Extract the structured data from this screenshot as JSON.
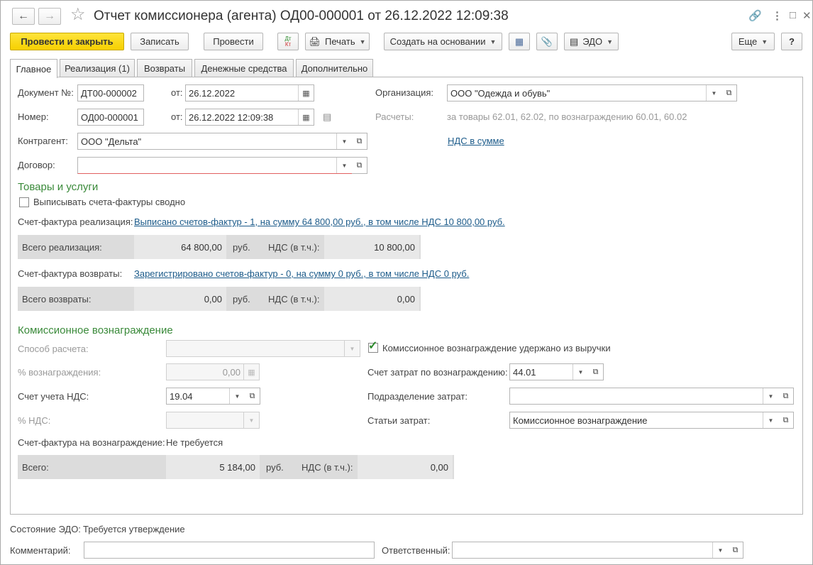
{
  "window": {
    "title": "Отчет комиссионера (агента) ОД00-000001 от 26.12.2022 12:09:38"
  },
  "toolbar": {
    "post_close": "Провести и закрыть",
    "save": "Записать",
    "post": "Провести",
    "dtkt": "Дт Кт",
    "print": "Печать",
    "create_based": "Создать на основании",
    "edo": "ЭДО",
    "more": "Еще",
    "help": "?"
  },
  "tabs": [
    "Главное",
    "Реализация (1)",
    "Возвраты",
    "Денежные средства",
    "Дополнительно"
  ],
  "main": {
    "doc_no_label": "Документ №:",
    "doc_no": "ДТ00-000002",
    "from_label": "от:",
    "doc_date": "26.12.2022",
    "number_label": "Номер:",
    "number": "ОД00-000001",
    "number_date": "26.12.2022 12:09:38",
    "org_label": "Организация:",
    "org": "ООО \"Одежда и обувь\"",
    "settlements_label": "Расчеты:",
    "settlements": "за товары 62.01, 62.02, по вознаграждению 60.01, 60.02",
    "counterparty_label": "Контрагент:",
    "counterparty": "ООО \"Дельта\"",
    "vat_link": "НДС в сумме",
    "contract_label": "Договор:",
    "contract": ""
  },
  "goods": {
    "title": "Товары и услуги",
    "summary_checkbox": "Выписывать счета-фактуры сводно",
    "invoice_sales_label": "Счет-фактура реализация:",
    "invoice_sales_link": "Выписано счетов-фактур - 1, на сумму 64 800,00 руб., в том числе НДС 10 800,00 руб.",
    "total_sales_label": "Всего реализация:",
    "total_sales": "64 800,00",
    "rub": "руб.",
    "vat_incl_label": "НДС (в т.ч.):",
    "vat_sales": "10 800,00",
    "invoice_returns_label": "Счет-фактура возвраты:",
    "invoice_returns_link": "Зарегистрировано счетов-фактур - 0, на сумму 0 руб., в том числе НДС 0 руб.",
    "total_returns_label": "Всего возвраты:",
    "total_returns": "0,00",
    "vat_returns": "0,00"
  },
  "commission": {
    "title": "Комиссионное вознаграждение",
    "method_label": "Способ расчета:",
    "method": "",
    "percent_label": "% вознаграждения:",
    "percent": "0,00",
    "vat_account_label": "Счет учета НДС:",
    "vat_account": "19.04",
    "vat_percent_label": "% НДС:",
    "vat_percent": "",
    "withheld_checkbox": "Комиссионное вознаграждение удержано из выручки",
    "withheld_checked": true,
    "cost_account_label": "Счет затрат по вознаграждению:",
    "cost_account": "44.01",
    "cost_dept_label": "Подразделение затрат:",
    "cost_dept": "",
    "cost_items_label": "Статьи затрат:",
    "cost_items": "Комиссионное вознаграждение",
    "invoice_label": "Счет-фактура на вознаграждение:",
    "invoice_value": "Не требуется",
    "total_label": "Всего:",
    "total": "5 184,00",
    "rub": "руб.",
    "vat_incl_label": "НДС (в т.ч.):",
    "vat": "0,00"
  },
  "footer": {
    "edo_state_label": "Состояние ЭДО:",
    "edo_state": "Требуется утверждение",
    "comment_label": "Комментарий:",
    "comment": "",
    "responsible_label": "Ответственный:",
    "responsible": ""
  }
}
